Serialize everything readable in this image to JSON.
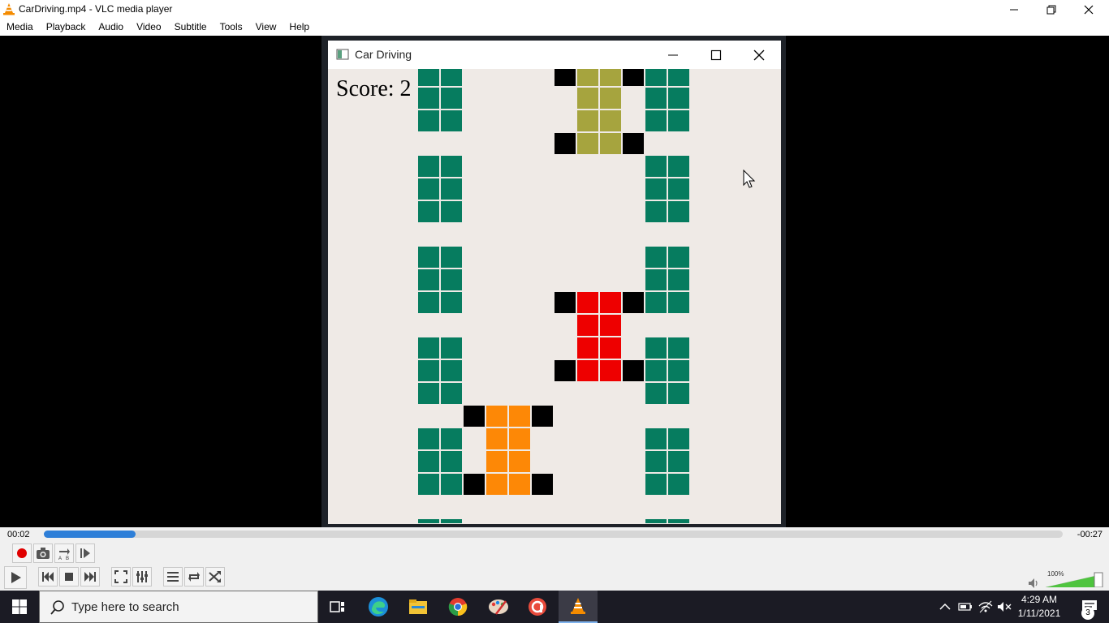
{
  "window": {
    "title": "CarDriving.mp4 - VLC media player",
    "icon": "vlc-cone-icon"
  },
  "menu": [
    "Media",
    "Playback",
    "Audio",
    "Video",
    "Subtitle",
    "Tools",
    "View",
    "Help"
  ],
  "game_window": {
    "title": "Car Driving",
    "score_text": "Score: 2"
  },
  "player": {
    "elapsed": "00:02",
    "remaining": "-00:27",
    "progress_fraction": 0.09,
    "volume_text": "100%",
    "volume_fraction": 1.0
  },
  "taskbar": {
    "search_placeholder": "Type here to search",
    "time": "4:29 AM",
    "date": "1/11/2021",
    "notification_count": "3",
    "apps": [
      "task-view-icon",
      "edge-icon",
      "file-explorer-icon",
      "chrome-icon",
      "paint-icon",
      "app-icon",
      "vlc-icon"
    ]
  },
  "colors": {
    "road_border": "#067c5f",
    "enemy_car_top": "#a6a43e",
    "enemy_car_mid": "#ee0000",
    "player_car": "#fd8806",
    "wheel": "#000000",
    "road_background": "#efeae6",
    "progress": "#2e7fd8"
  }
}
